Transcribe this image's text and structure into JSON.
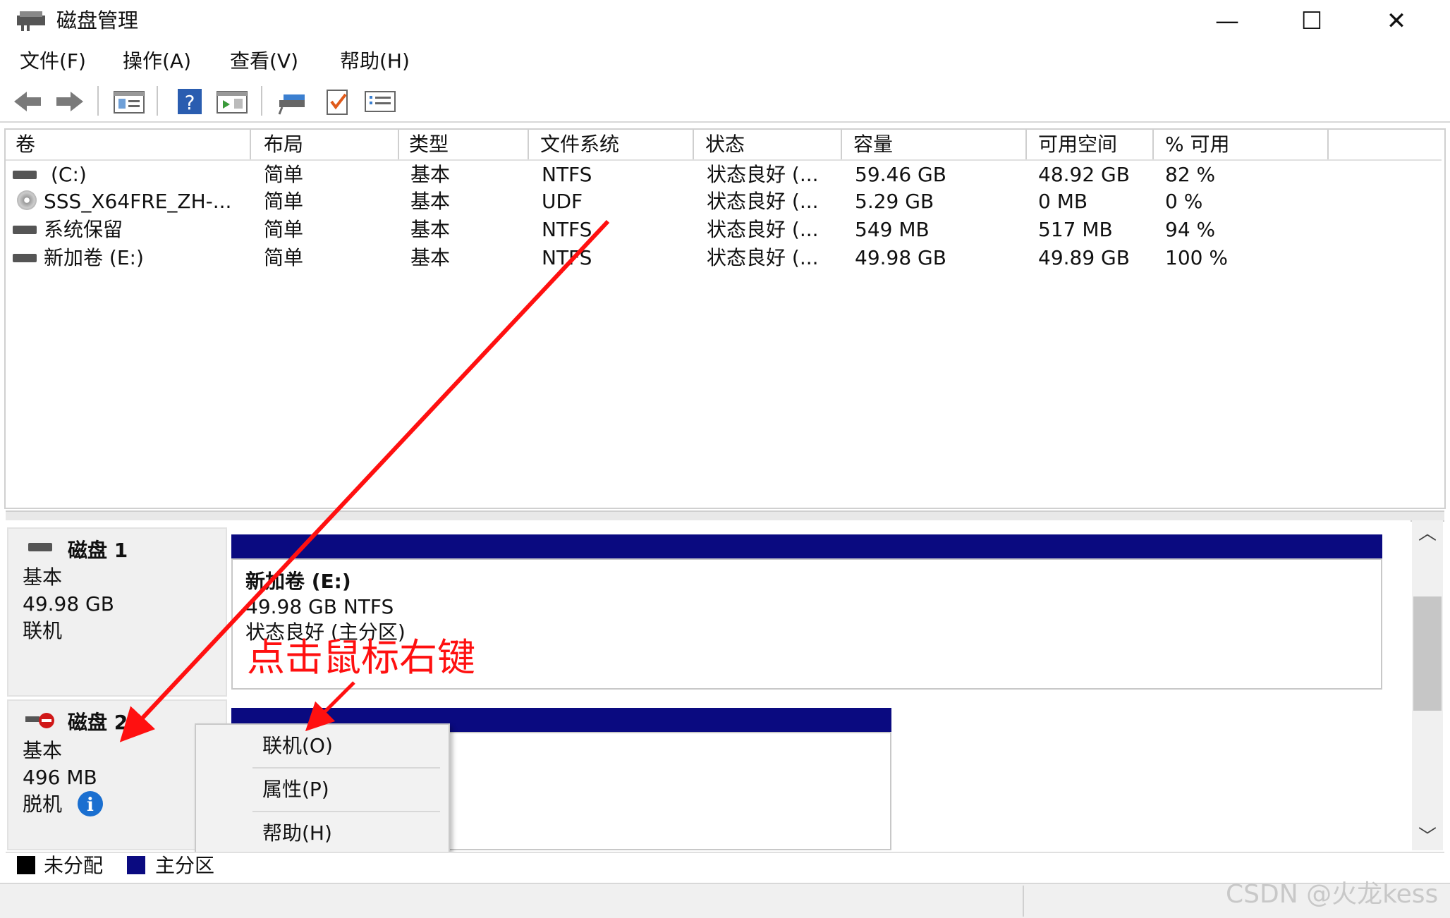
{
  "window": {
    "title": "磁盘管理",
    "minimize_glyph": "—",
    "maximize_glyph": "☐",
    "close_glyph": "✕"
  },
  "menu": [
    "文件(F)",
    "操作(A)",
    "查看(V)",
    "帮助(H)"
  ],
  "toolbar_icons": [
    "back-arrow-icon",
    "forward-arrow-icon",
    "console-tree-icon",
    "help-icon",
    "action-pane-icon",
    "connect-icon",
    "check-list-icon",
    "properties-list-icon"
  ],
  "volume_table": {
    "columns": [
      "卷",
      "布局",
      "类型",
      "文件系统",
      "状态",
      "容量",
      "可用空间",
      "% 可用"
    ],
    "rows": [
      {
        "volume": "(C:)",
        "layout": "简单",
        "type": "基本",
        "fs": "NTFS",
        "status": "状态良好 (...",
        "capacity": "59.46 GB",
        "free": "48.92 GB",
        "pct": "82 %"
      },
      {
        "volume": "SSS_X64FRE_ZH-...",
        "layout": "简单",
        "type": "基本",
        "fs": "UDF",
        "status": "状态良好 (...",
        "capacity": "5.29 GB",
        "free": "0 MB",
        "pct": "0 %"
      },
      {
        "volume": "系统保留",
        "layout": "简单",
        "type": "基本",
        "fs": "NTFS",
        "status": "状态良好 (...",
        "capacity": "549 MB",
        "free": "517 MB",
        "pct": "94 %"
      },
      {
        "volume": "新加卷 (E:)",
        "layout": "简单",
        "type": "基本",
        "fs": "NTFS",
        "status": "状态良好 (...",
        "capacity": "49.98 GB",
        "free": "49.89 GB",
        "pct": "100 %"
      }
    ]
  },
  "disks": [
    {
      "name": "磁盘 1",
      "type": "基本",
      "size": "49.98 GB",
      "state": "联机",
      "partition": {
        "name": "新加卷 (E:)",
        "detail": "49.98 GB NTFS",
        "status": "状态良好 (主分区)"
      }
    },
    {
      "name": "磁盘 2",
      "type": "基本",
      "size": "496 MB",
      "state": "脱机"
    }
  ],
  "context_menu": [
    "联机(O)",
    "属性(P)",
    "帮助(H)"
  ],
  "legend": [
    {
      "label": "未分配",
      "color": "#000000"
    },
    {
      "label": "主分区",
      "color": "#0a0a80"
    }
  ],
  "annotation": {
    "text": "点击鼠标右键",
    "color": "#ff1010"
  },
  "watermark": "CSDN @火龙kess"
}
